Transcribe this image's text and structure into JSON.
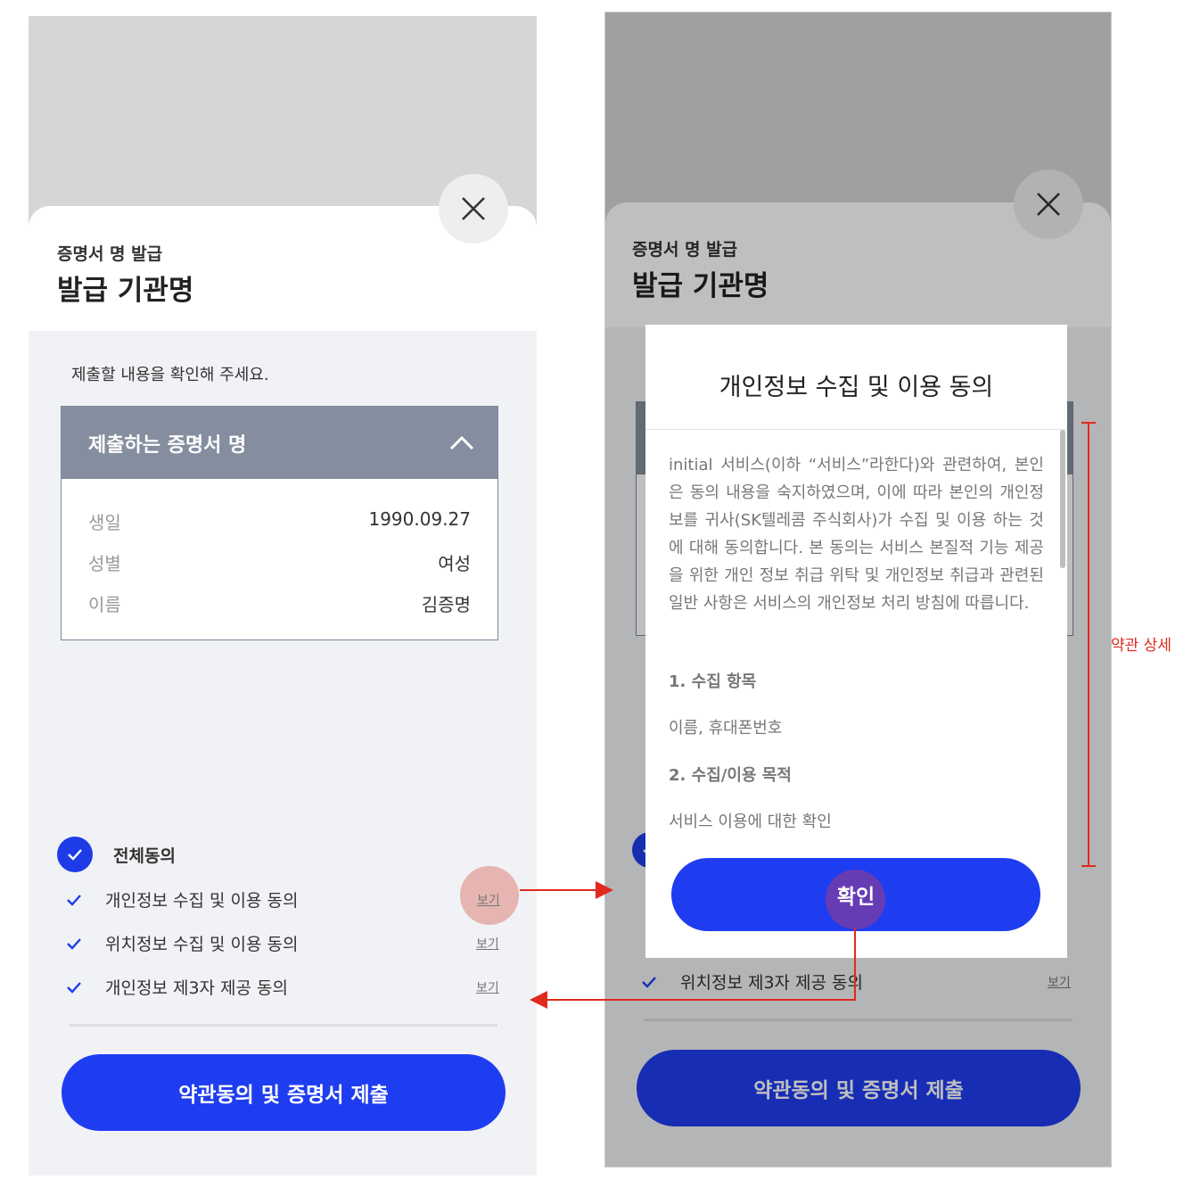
{
  "screen_left": {
    "header": {
      "subtitle": "증명서 명 발급",
      "title": "발급 기관명",
      "close_icon": "close-icon"
    },
    "confirm_text": "제출할 내용을 확인해 주세요.",
    "certificate": {
      "name": "제출하는 증명서 명",
      "toggle_icon": "chevron-up-icon",
      "rows": [
        {
          "label": "생일",
          "value": "1990.09.27"
        },
        {
          "label": "성별",
          "value": "여성"
        },
        {
          "label": "이름",
          "value": "김증명"
        }
      ]
    },
    "agreements": {
      "all_label": "전체동의",
      "items": [
        {
          "label": "개인정보 수집 및 이용 동의",
          "view": "보기"
        },
        {
          "label": "위치정보 수집 및 이용 동의",
          "view": "보기"
        },
        {
          "label": "개인정보 제3자 제공 동의",
          "view": "보기"
        }
      ]
    },
    "submit_label": "약관동의 및 증명서 제출"
  },
  "screen_right": {
    "header": {
      "subtitle": "증명서 명 발급",
      "title": "발급 기관명"
    },
    "agreements": {
      "items": [
        {
          "label": "위치정보 제3자 제공 동의",
          "view": "보기"
        }
      ]
    },
    "submit_label": "약관동의 및 증명서 제출",
    "modal": {
      "title": "개인정보 수집 및 이용 동의",
      "body": "initial 서비스(이하 “서비스”라한다)와 관련하여, 본인은 동의 내용을 숙지하였으며, 이에 따라 본인의 개인정보를 귀사(SK텔레콤 주식회사)가 수집 및 이용 하는 것에 대해 동의합니다. 본 동의는 서비스 본질적 기능 제공을 위한 개인 정보 취급 위탁 및 개인정보 취급과 관련된 일반 사항은 서비스의 개인정보 처리 방침에 따릅니다.",
      "section1_title": "1.   수집 항목",
      "section1_text": "이름, 휴대폰번호",
      "section2_title": "2.   수집/이용 목적",
      "section2_text": "서비스 이용에 대한 확인",
      "confirm_label": "확인"
    }
  },
  "annotation": {
    "label": "약관 상세",
    "color": "#e02a1e"
  },
  "colors": {
    "primary": "#1f3df0",
    "card_header": "#858e9f"
  }
}
